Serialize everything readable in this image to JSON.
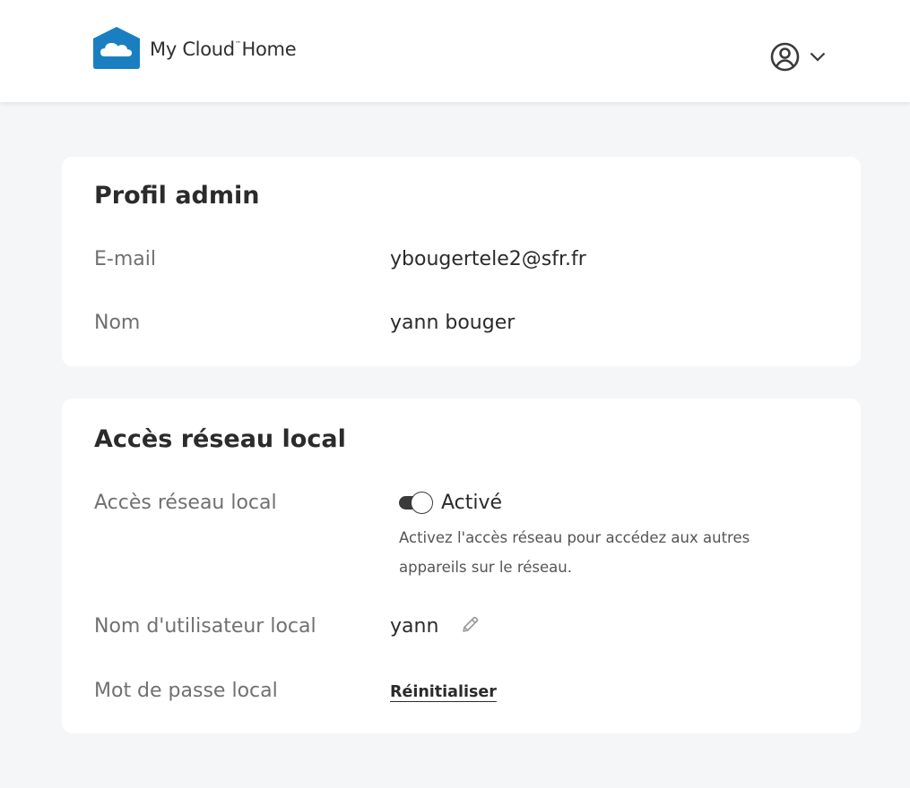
{
  "header": {
    "brand": {
      "name_part1": "My Cloud",
      "tm": "™",
      "name_part2": "Home"
    },
    "account_icon": "user-circle-icon",
    "dropdown_icon": "chevron-down-icon"
  },
  "profile_card": {
    "title": "Profil admin",
    "rows": [
      {
        "label": "E-mail",
        "value": "ybougertele2@sfr.fr"
      },
      {
        "label": "Nom",
        "value": "yann bouger"
      }
    ]
  },
  "network_card": {
    "title": "Accès réseau local",
    "access": {
      "label": "Accès réseau local",
      "toggle_state": "Activé",
      "enabled": true,
      "help": "Activez l'accès réseau pour accédez aux autres appareils sur le réseau."
    },
    "username": {
      "label": "Nom d'utilisateur local",
      "value": "yann",
      "edit_icon": "pencil-icon"
    },
    "password": {
      "label": "Mot de passe local",
      "action": "Réinitialiser"
    }
  },
  "colors": {
    "brand_blue": "#1a7fc1",
    "page_bg": "#f5f6f8",
    "card_bg": "#ffffff",
    "text_dark": "#2b2b2b",
    "text_muted": "#707070"
  }
}
